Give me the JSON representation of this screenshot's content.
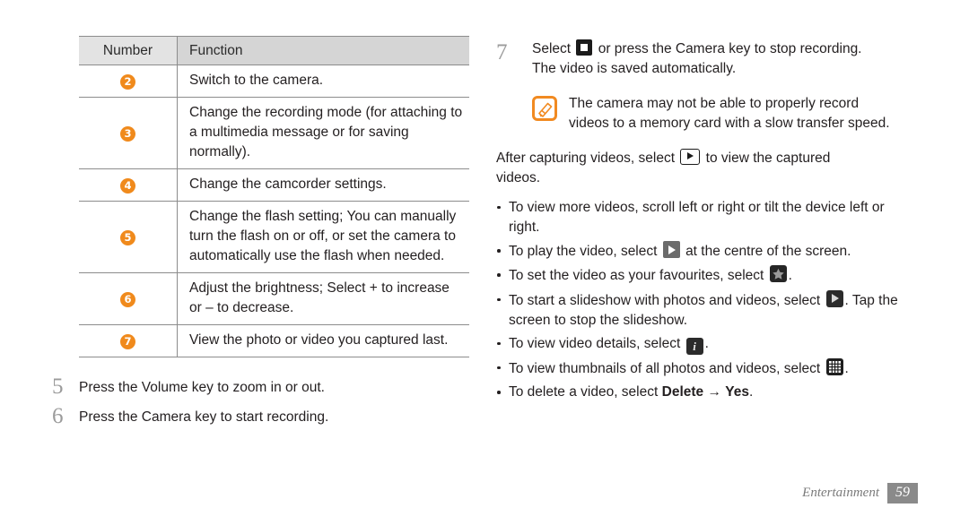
{
  "table": {
    "headers": {
      "number": "Number",
      "function": "Function"
    },
    "rows": [
      {
        "number": "2",
        "function": "Switch to the camera."
      },
      {
        "number": "3",
        "function": "Change the recording mode (for attaching to a multimedia message or for saving normally)."
      },
      {
        "number": "4",
        "function": "Change the camcorder settings."
      },
      {
        "number": "5",
        "function": "Change the flash setting; You can manually turn the flash on or off, or set the camera to automatically use the flash when needed."
      },
      {
        "number": "6",
        "function": "Adjust the brightness; Select + to increase or – to decrease."
      },
      {
        "number": "7",
        "function": "View the photo or video you captured last."
      }
    ]
  },
  "left_steps": [
    {
      "num": "5",
      "text": "Press the Volume key to zoom in or out."
    },
    {
      "num": "6",
      "text": "Press the Camera key to start recording."
    }
  ],
  "right": {
    "step": {
      "num": "7",
      "text_before": "Select",
      "text_after": "or press the Camera key to stop recording.",
      "text_line2": "The video is saved automatically.",
      "icon": "stop-recording-icon"
    },
    "note": {
      "icon": "note-pen-icon",
      "line1": "The camera may not be able to properly record",
      "line2": "videos to a memory card with a slow transfer speed."
    },
    "paragraph": {
      "before": "After capturing videos, select",
      "after": "to view the captured",
      "line2": "videos.",
      "icon": "play-box-icon"
    },
    "bullets": [
      {
        "before": "To view more videos, scroll left or right or tilt the device left or right.",
        "icon": null,
        "after": ""
      },
      {
        "before": "To play the video, select",
        "icon": "play-gray-icon",
        "after": "at the centre of the screen."
      },
      {
        "before": "To set the video as your favourites, select",
        "icon": "star-icon",
        "after": "."
      },
      {
        "before": "To start a slideshow with photos and videos, select",
        "icon": "play-dark-icon",
        "after": ". Tap the screen to stop the slideshow."
      },
      {
        "before": "To view video details, select",
        "icon": "info-icon",
        "after": "."
      },
      {
        "before": "To view thumbnails of all photos and videos, select",
        "icon": "grid-icon",
        "after": "."
      },
      {
        "before": "To delete a video, select",
        "icon": null,
        "bold1": "Delete",
        "arrow": " → ",
        "bold2": "Yes",
        "after": "."
      }
    ]
  },
  "footer": {
    "section": "Entertainment",
    "page": "59"
  },
  "colors": {
    "accent_orange": "#f08a1c",
    "header_gray": "#d5d5d5",
    "header_gray_light": "#e3e3e3",
    "rule_gray": "#8c8c8c",
    "footer_gray": "#8a8a8a",
    "text": "#231f20"
  }
}
